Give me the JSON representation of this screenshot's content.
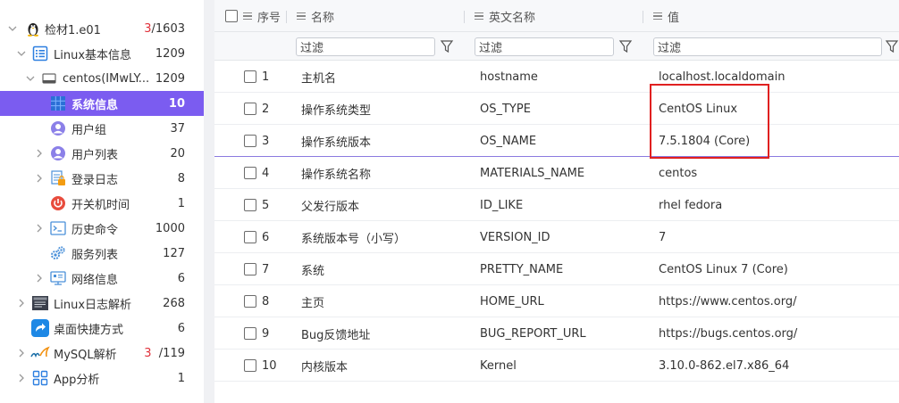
{
  "sidebar": {
    "items": [
      {
        "label": "检材1.e01",
        "count_red": "3",
        "count": "/1603",
        "icon": "penguin-icon",
        "depth": 0,
        "expanded": true
      },
      {
        "label": "Linux基本信息",
        "count": "1209",
        "icon": "list-document-icon",
        "depth": 1,
        "expanded": true
      },
      {
        "label": "centos(IMwLY...",
        "count": "1209",
        "icon": "disk-icon",
        "depth": 2,
        "expanded": true
      },
      {
        "label": "系统信息",
        "count": "10",
        "icon": "system-grid-icon",
        "depth": 3,
        "selected": true
      },
      {
        "label": "用户组",
        "count": "37",
        "icon": "user-group-icon",
        "depth": 3
      },
      {
        "label": "用户列表",
        "count": "20",
        "icon": "user-list-icon",
        "depth": 3,
        "has_caret": true
      },
      {
        "label": "登录日志",
        "count": "8",
        "icon": "login-log-icon",
        "depth": 3,
        "has_caret": true
      },
      {
        "label": "开关机时间",
        "count": "1",
        "icon": "power-icon",
        "depth": 3
      },
      {
        "label": "历史命令",
        "count": "1000",
        "icon": "terminal-icon",
        "depth": 3,
        "has_caret": true
      },
      {
        "label": "服务列表",
        "count": "127",
        "icon": "services-icon",
        "depth": 3
      },
      {
        "label": "网络信息",
        "count": "6",
        "icon": "network-icon",
        "depth": 3,
        "has_caret": true
      },
      {
        "label": "Linux日志解析",
        "count": "268",
        "icon": "log-file-icon",
        "depth": 1,
        "has_caret": true
      },
      {
        "label": "桌面快捷方式",
        "count": "6",
        "icon": "shortcut-icon",
        "depth": 1
      },
      {
        "label": "MySQL解析",
        "count_red": "3",
        "count": "/119",
        "icon": "mysql-icon",
        "depth": 1,
        "has_caret": true
      },
      {
        "label": "App分析",
        "count": "1",
        "icon": "app-grid-icon",
        "depth": 1,
        "has_caret": true
      }
    ]
  },
  "grid": {
    "columns": {
      "index": "序号",
      "name": "名称",
      "english_name": "英文名称",
      "value": "值"
    },
    "filter_placeholder": "过滤",
    "rows": [
      {
        "index": "1",
        "name": "主机名",
        "english_name": "hostname",
        "value": "localhost.localdomain"
      },
      {
        "index": "2",
        "name": "操作系统类型",
        "english_name": "OS_TYPE",
        "value": "CentOS Linux"
      },
      {
        "index": "3",
        "name": "操作系统版本",
        "english_name": "OS_NAME",
        "value": "7.5.1804 (Core)"
      },
      {
        "index": "4",
        "name": "操作系统名称",
        "english_name": "MATERIALS_NAME",
        "value": "centos"
      },
      {
        "index": "5",
        "name": "父发行版本",
        "english_name": "ID_LIKE",
        "value": "rhel fedora"
      },
      {
        "index": "6",
        "name": "系统版本号（小写）",
        "english_name": "VERSION_ID",
        "value": "7"
      },
      {
        "index": "7",
        "name": "系统",
        "english_name": "PRETTY_NAME",
        "value": "CentOS Linux 7 (Core)"
      },
      {
        "index": "8",
        "name": "主页",
        "english_name": "HOME_URL",
        "value": "https://www.centos.org/"
      },
      {
        "index": "9",
        "name": "Bug反馈地址",
        "english_name": "BUG_REPORT_URL",
        "value": "https://bugs.centos.org/"
      },
      {
        "index": "10",
        "name": "内核版本",
        "english_name": "Kernel",
        "value": "3.10.0-862.el7.x86_64"
      }
    ]
  },
  "colors": {
    "selected_row": "#7b5cf0",
    "highlight_box": "#e02020",
    "count_red": "#e0303a"
  }
}
